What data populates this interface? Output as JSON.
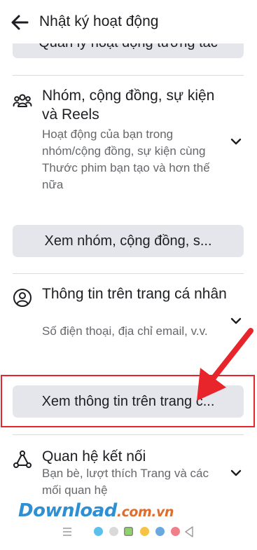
{
  "header": {
    "title": "Nhật ký hoạt động"
  },
  "top_button": {
    "label": "Quản lý hoạt động tương tác"
  },
  "sections": [
    {
      "title": "Nhóm, cộng đồng, sự kiện và Reels",
      "description": "Hoạt động của bạn trong nhóm/cộng đồng, sự kiện cùng Thước phim bạn tạo và hơn thế nữa",
      "icon": "people-group-icon",
      "button_label": "Xem nhóm, cộng đồng, s..."
    },
    {
      "title": "Thông tin trên trang cá nhân",
      "description": "Số điện thoại, địa chỉ email, v.v.",
      "icon": "profile-circle-icon",
      "button_label": "Xem thông tin trên trang c..."
    },
    {
      "title": "Quan hệ kết nối",
      "description": "Bạn bè, lượt thích Trang và các mối quan hệ",
      "icon": "connections-icon"
    }
  ],
  "watermark": {
    "main": "Download",
    "tld": ".com.vn"
  },
  "colors": {
    "highlight_red": "#e8252b",
    "button_bg": "#e4e6eb",
    "secondary_text": "#65676b",
    "watermark_blue": "#2f8fd3",
    "watermark_orange": "#e06d2c"
  },
  "navbar_dots": [
    "#5bc0eb",
    "#d9d9d9",
    "#8fd16b",
    "#f6c344",
    "#6aa8e0",
    "#f07f89"
  ]
}
